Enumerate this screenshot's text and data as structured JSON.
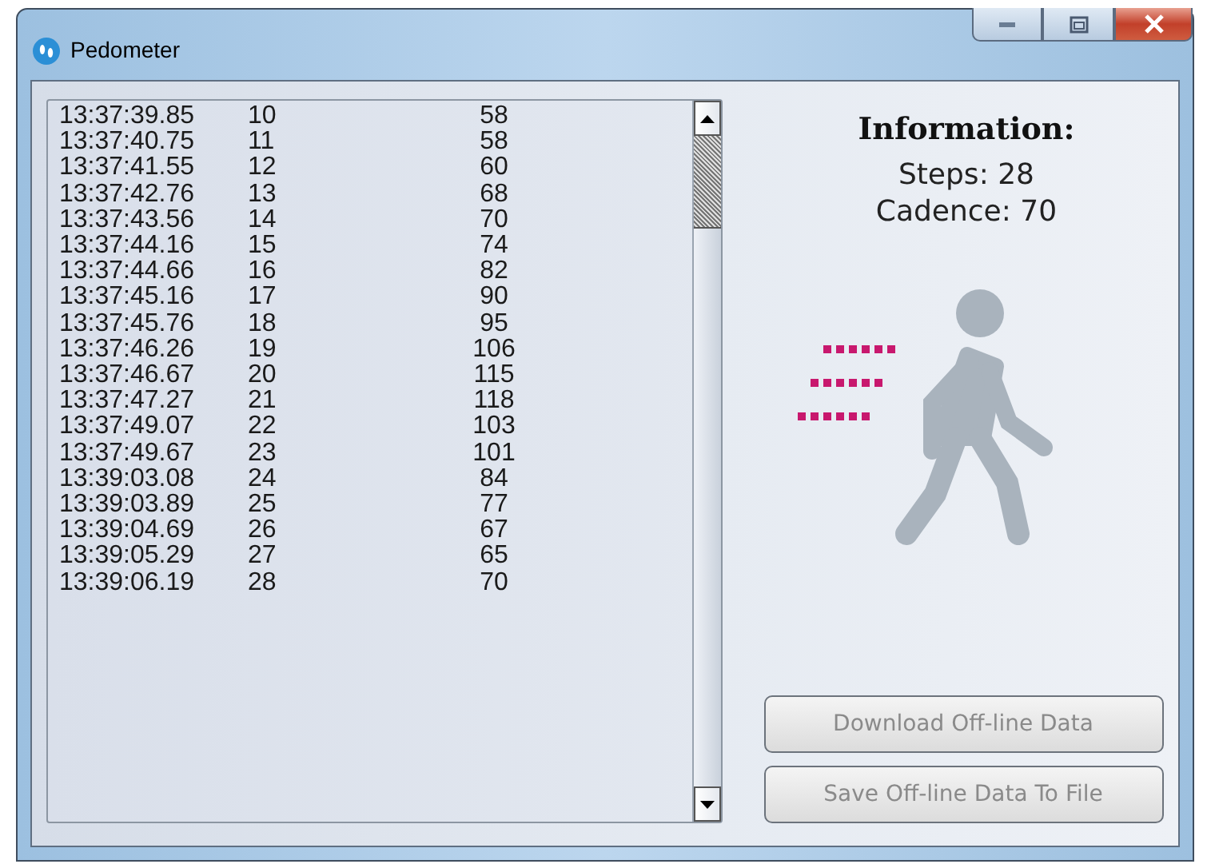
{
  "window": {
    "title": "Pedometer"
  },
  "log": {
    "rows": [
      {
        "time": "13:37:39.85",
        "step": "10",
        "cadence": "58"
      },
      {
        "time": "13:37:40.75",
        "step": "11",
        "cadence": "58"
      },
      {
        "time": "13:37:41.55",
        "step": "12",
        "cadence": "60"
      },
      {
        "time": "13:37:42.76",
        "step": "13",
        "cadence": "68"
      },
      {
        "time": "13:37:43.56",
        "step": "14",
        "cadence": "70"
      },
      {
        "time": "13:37:44.16",
        "step": "15",
        "cadence": "74"
      },
      {
        "time": "13:37:44.66",
        "step": "16",
        "cadence": "82"
      },
      {
        "time": "13:37:45.16",
        "step": "17",
        "cadence": "90"
      },
      {
        "time": "13:37:45.76",
        "step": "18",
        "cadence": "95"
      },
      {
        "time": "13:37:46.26",
        "step": "19",
        "cadence": "106"
      },
      {
        "time": "13:37:46.67",
        "step": "20",
        "cadence": "115"
      },
      {
        "time": "13:37:47.27",
        "step": "21",
        "cadence": "118"
      },
      {
        "time": "13:37:49.07",
        "step": "22",
        "cadence": "103"
      },
      {
        "time": "13:37:49.67",
        "step": "23",
        "cadence": "101"
      },
      {
        "time": "13:39:03.08",
        "step": "24",
        "cadence": "84"
      },
      {
        "time": "13:39:03.89",
        "step": "25",
        "cadence": "77"
      },
      {
        "time": "13:39:04.69",
        "step": "26",
        "cadence": "67"
      },
      {
        "time": "13:39:05.29",
        "step": "27",
        "cadence": "65"
      },
      {
        "time": "13:39:06.19",
        "step": "28",
        "cadence": "70"
      }
    ]
  },
  "info": {
    "heading": "Information:",
    "lines": [
      "Steps: 28",
      "Cadence: 70"
    ]
  },
  "buttons": [
    {
      "label": "Download Off-line Data",
      "disabled": true
    },
    {
      "label": "Save Off-line Data To File",
      "disabled": true
    }
  ]
}
